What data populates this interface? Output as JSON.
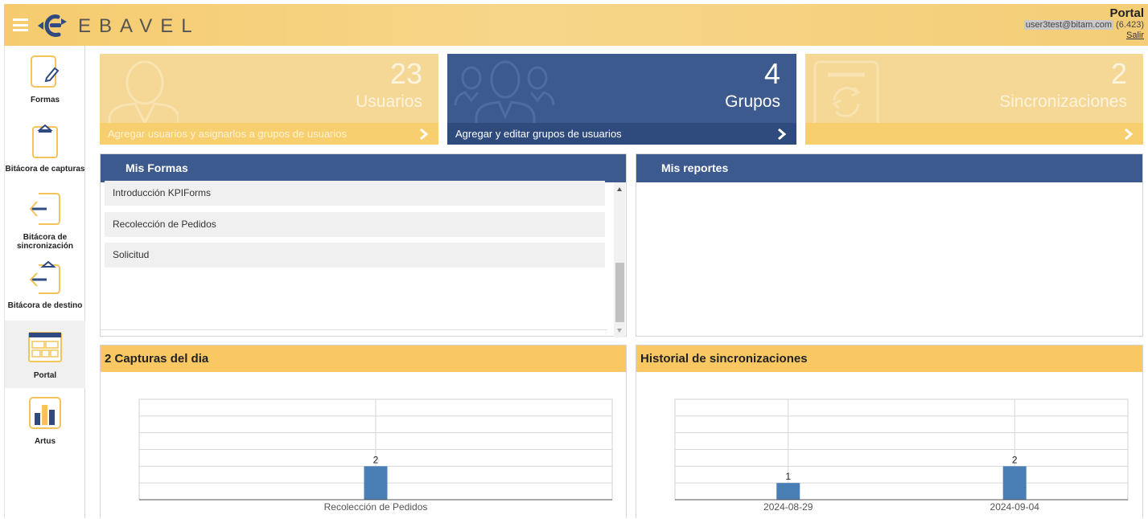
{
  "header": {
    "brand": "EBAVEL",
    "page_title": "Portal",
    "user_email": "user3test@bitam.com",
    "version": "(6.423)",
    "logout": "Salir"
  },
  "sidebar": {
    "items": [
      {
        "label": "Formas",
        "icon": "form-pen-icon"
      },
      {
        "label": "Bitácora de capturas",
        "icon": "clipboard-icon"
      },
      {
        "label": "Bitácora de sincronización",
        "icon": "arrow-left-icon"
      },
      {
        "label": "Bitácora de destino",
        "icon": "clipboard-arrow-icon"
      },
      {
        "label": "Portal",
        "icon": "portal-grid-icon",
        "active": true
      },
      {
        "label": "Artus",
        "icon": "bar-chart-icon"
      }
    ]
  },
  "tiles": [
    {
      "count": "23",
      "name": "Usuarios",
      "footer": "Agregar usuarios y asignarlos a grupos de usuarios",
      "style": "light",
      "icon": "user-icon"
    },
    {
      "count": "4",
      "name": "Grupos",
      "footer": "Agregar y editar grupos de usuarios",
      "style": "dark",
      "icon": "group-icon"
    },
    {
      "count": "2",
      "name": "Sincronizaciones",
      "footer": "",
      "style": "light",
      "icon": "sync-icon"
    }
  ],
  "mis_formas": {
    "title": "Mis Formas",
    "items": [
      "Introducción KPIForms",
      "Recolección de Pedidos",
      "Solicitud"
    ]
  },
  "mis_reportes": {
    "title": "Mis reportes"
  },
  "colors": {
    "header_yellow": "#f5cb6e",
    "navy": "#3d5a8f",
    "panel_yellow": "#f9c863",
    "bar_blue": "#4a7fb5"
  },
  "chart_data": [
    {
      "type": "bar",
      "title": "2 Capturas del dia",
      "categories": [
        "Recolección de Pedidos"
      ],
      "values": [
        2
      ],
      "ylim": [
        0,
        6
      ],
      "grid": true
    },
    {
      "type": "bar",
      "title": "Historial de sincronizaciones",
      "categories": [
        "2024-08-29",
        "2024-09-04"
      ],
      "values": [
        1,
        2
      ],
      "ylim": [
        0,
        6
      ],
      "grid": true
    }
  ]
}
